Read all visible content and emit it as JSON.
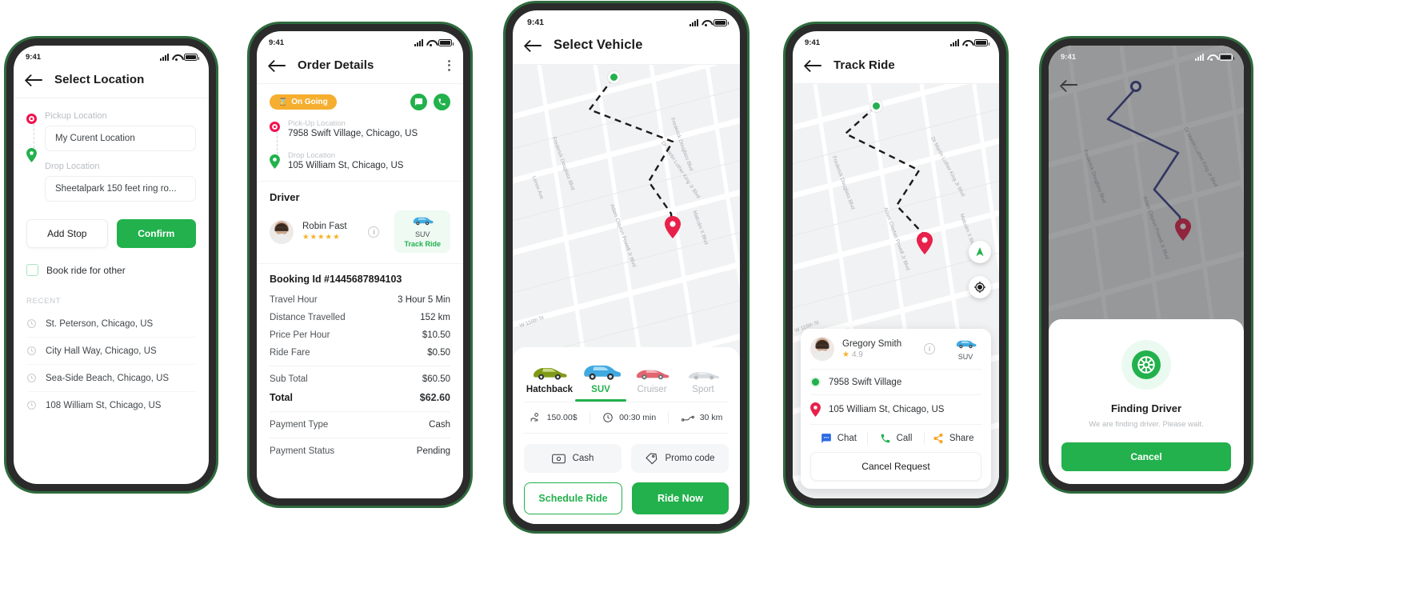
{
  "colors": {
    "primary_green": "#22b14c",
    "accent_red": "#f2124f",
    "badge_orange": "#f5ae2e",
    "star_yellow": "#f5b125",
    "muted_grey": "#b9bdc2"
  },
  "status_bar": {
    "time": "9:41"
  },
  "screen1": {
    "title": "Select Location",
    "pickup_label": "Pickup Location",
    "pickup_value": "My Curent Location",
    "drop_label": "Drop Location",
    "drop_value": "Sheetalpark 150 feet ring ro...",
    "add_stop_label": "Add Stop",
    "confirm_label": "Confirm",
    "book_for_other_label": "Book ride for other",
    "recent_header": "RECENT",
    "recent_items": [
      "St. Peterson, Chicago, US",
      "City Hall Way, Chicago, US",
      "Sea-Side Beach, Chicago, US",
      "108 William St, Chicago, US"
    ]
  },
  "screen2": {
    "title": "Order Details",
    "status_badge": "On Going",
    "pickup_label": "Pick-Up Location",
    "pickup_value": "7958 Swift Village, Chicago, US",
    "drop_label": "Drop Location",
    "drop_value": "105 William St, Chicago, US",
    "driver_header": "Driver",
    "driver_name": "Robin Fast",
    "driver_stars": "★★★★★",
    "vehicle_label": "SUV",
    "track_ride_label": "Track Ride",
    "booking_id": "Booking Id #1445687894103",
    "rows": [
      {
        "label": "Travel Hour",
        "value": "3 Hour 5 Min"
      },
      {
        "label": "Distance Travelled",
        "value": "152 km"
      },
      {
        "label": "Price Per Hour",
        "value": "$10.50"
      },
      {
        "label": "Ride Fare",
        "value": "$0.50"
      }
    ],
    "sub_total": {
      "label": "Sub Total",
      "value": "$60.50"
    },
    "total": {
      "label": "Total",
      "value": "$62.60"
    },
    "payment_rows": [
      {
        "label": "Payment Type",
        "value": "Cash"
      },
      {
        "label": "Payment Status",
        "value": "Pending"
      }
    ]
  },
  "screen3": {
    "title": "Select Vehicle",
    "map_labels": [
      "Dr Martin Luther King Jr Blvd",
      "Frederick Douglass Blvd",
      "Adam Clayton Powell Jr Blvd",
      "Malcolm X Blvd",
      "Lenox Ave",
      "W 116th St"
    ],
    "vehicles": [
      {
        "name": "Hatchback",
        "active": false
      },
      {
        "name": "SUV",
        "active": true
      },
      {
        "name": "Cruiser",
        "active": false
      },
      {
        "name": "Sport",
        "active": false
      }
    ],
    "price": "150.00$",
    "duration": "00:30 min",
    "distance": "30 km",
    "cash_label": "Cash",
    "promo_label": "Promo code",
    "schedule_label": "Schedule Ride",
    "ride_now_label": "Ride Now"
  },
  "screen4": {
    "title": "Track Ride",
    "driver_name": "Gregory Smith",
    "driver_rating": "4.9",
    "vehicle_label": "SUV",
    "pickup_value": "7958 Swift Village",
    "drop_value": "105 William St, Chicago, US",
    "chat_label": "Chat",
    "call_label": "Call",
    "share_label": "Share",
    "cancel_request_label": "Cancel Request"
  },
  "screen5": {
    "finding_title": "Finding Driver",
    "finding_sub": "We are finding driver. Please wait.",
    "cancel_label": "Cancel"
  }
}
